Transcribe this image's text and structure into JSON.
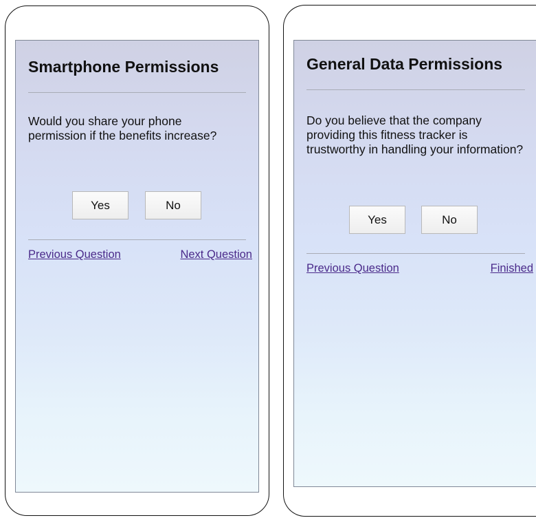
{
  "screens": [
    {
      "title": "Smartphone Permissions",
      "question": "Would you share your phone permission if the benefits increase?",
      "yes_label": "Yes",
      "no_label": "No",
      "previous_label": "Previous Question",
      "next_label": "Next Question"
    },
    {
      "title": "General Data Permissions",
      "question": "Do you believe that the company providing this fitness tracker is trustworthy in handling your information?",
      "yes_label": "Yes",
      "no_label": "No",
      "previous_label": "Previous Question",
      "next_label": "Finished"
    }
  ],
  "colors": {
    "link": "#4a2a8a",
    "gradient_top": "#cfd1e4",
    "gradient_bottom": "#eef8fc",
    "frame": "#111111"
  }
}
